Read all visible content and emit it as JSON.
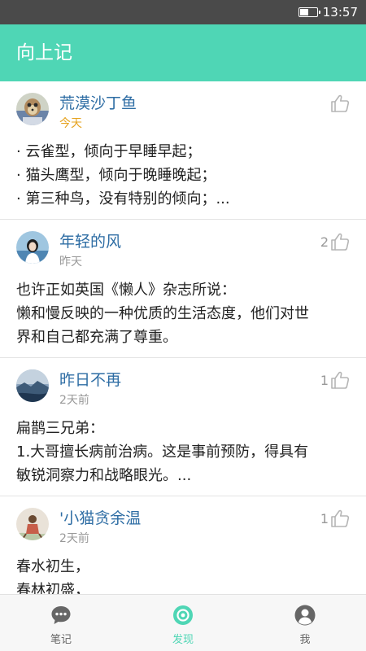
{
  "status_bar": {
    "time": "13:57",
    "battery_level": 0.55
  },
  "app_bar": {
    "title": "向上记"
  },
  "posts": [
    {
      "author": "荒漠沙丁鱼",
      "time": "今天",
      "likes": "",
      "content": [
        "· 云雀型，倾向于早睡早起；",
        "· 猫头鹰型，倾向于晚睡晚起；",
        "· 第三种鸟，没有特别的倾向；..."
      ]
    },
    {
      "author": "年轻的风",
      "time": "昨天",
      "likes": "2",
      "content": [
        "也许正如英国《懒人》杂志所说：",
        "懒和慢反映的一种优质的生活态度，他们对世",
        "界和自己都充满了尊重。"
      ]
    },
    {
      "author": "昨日不再",
      "time": "2天前",
      "likes": "1",
      "content": [
        "扁鹊三兄弟：",
        "1.大哥擅长病前治病。这是事前预防，得具有",
        "敏锐洞察力和战略眼光。..."
      ]
    },
    {
      "author": "'小猫贪余温",
      "time": "2天前",
      "likes": "1",
      "content": [
        "春水初生，",
        "春林初盛，"
      ]
    }
  ],
  "bottom_nav": {
    "tabs": [
      {
        "label": "笔记",
        "icon": "chat-bubble-icon"
      },
      {
        "label": "发现",
        "icon": "discover-icon"
      },
      {
        "label": "我",
        "icon": "user-icon"
      }
    ],
    "active_tab": "发现"
  },
  "colors": {
    "accent": "#4fd6b5",
    "author_name": "#2e6da4",
    "today": "#e6a320",
    "status_bar": "#4a4a4a"
  }
}
